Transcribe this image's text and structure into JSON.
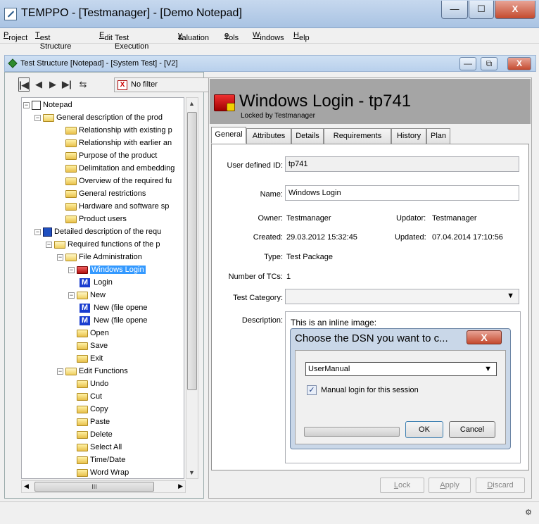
{
  "window": {
    "title": "TEMPPO - [Testmanager] - [Demo Notepad]",
    "minimize": "—",
    "maximize": "☐",
    "close": "X"
  },
  "menu": [
    {
      "pre": "",
      "ul": "P",
      "post": "roject"
    },
    {
      "pre": "",
      "ul": "T",
      "post": "est Structure"
    },
    {
      "pre": "",
      "ul": "E",
      "post": "dit"
    },
    {
      "pre": "Test Execution",
      "ul": "",
      "post": ""
    },
    {
      "pre": "E",
      "ul": "v",
      "post": "aluation"
    },
    {
      "pre": "T",
      "ul": "o",
      "post": "ols"
    },
    {
      "pre": "",
      "ul": "W",
      "post": "indows"
    },
    {
      "pre": "",
      "ul": "H",
      "post": "elp"
    }
  ],
  "inner_window": {
    "title": "Test Structure [Notepad] - [System Test] - [V2]",
    "minimize": "—",
    "restore": "⧉",
    "close": "X"
  },
  "tree_toolbar": {
    "filter_label": "No filter"
  },
  "tree": [
    {
      "label": "Notepad",
      "level": 0,
      "type": "book",
      "exp": "−"
    },
    {
      "label": "General description of the prod",
      "level": 1,
      "type": "open",
      "exp": "−"
    },
    {
      "label": "Relationship with existing p",
      "level": 3,
      "type": "folder"
    },
    {
      "label": "Relationship with earlier an",
      "level": 3,
      "type": "folder"
    },
    {
      "label": "Purpose of the product",
      "level": 3,
      "type": "folder"
    },
    {
      "label": "Delimitation and embedding",
      "level": 3,
      "type": "folder"
    },
    {
      "label": "Overview of the required fu",
      "level": 3,
      "type": "folder"
    },
    {
      "label": "General restrictions",
      "level": 3,
      "type": "folder"
    },
    {
      "label": "Hardware and software sp",
      "level": 3,
      "type": "folder"
    },
    {
      "label": "Product users",
      "level": 3,
      "type": "folder"
    },
    {
      "label": "Detailed description of the requ",
      "level": 1,
      "type": "book2",
      "exp": "−"
    },
    {
      "label": "Required functions of the p",
      "level": 2,
      "type": "open",
      "exp": "−"
    },
    {
      "label": "File Administration",
      "level": 3,
      "type": "open",
      "exp": "−"
    },
    {
      "label": "Windows Login",
      "level": 4,
      "type": "red",
      "exp": "−",
      "selected": true
    },
    {
      "label": "Login",
      "level": 5,
      "type": "m"
    },
    {
      "label": "New",
      "level": 4,
      "type": "open",
      "exp": "−"
    },
    {
      "label": "New (file opene",
      "level": 5,
      "type": "m"
    },
    {
      "label": "New (file opene",
      "level": 5,
      "type": "m"
    },
    {
      "label": "Open",
      "level": 4,
      "type": "folder"
    },
    {
      "label": "Save",
      "level": 4,
      "type": "folder"
    },
    {
      "label": "Exit",
      "level": 4,
      "type": "folder"
    },
    {
      "label": "Edit Functions",
      "level": 3,
      "type": "open",
      "exp": "−"
    },
    {
      "label": "Undo",
      "level": 4,
      "type": "folder"
    },
    {
      "label": "Cut",
      "level": 4,
      "type": "folder"
    },
    {
      "label": "Copy",
      "level": 4,
      "type": "folder"
    },
    {
      "label": "Paste",
      "level": 4,
      "type": "folder"
    },
    {
      "label": "Delete",
      "level": 4,
      "type": "folder"
    },
    {
      "label": "Select All",
      "level": 4,
      "type": "folder"
    },
    {
      "label": "Time/Date",
      "level": 4,
      "type": "folder"
    },
    {
      "label": "Word Wrap",
      "level": 4,
      "type": "folder"
    }
  ],
  "scroll": {
    "h_thumb": "III"
  },
  "detail": {
    "title": "Windows Login - tp741",
    "locked_by": "Locked by Testmanager",
    "tabs": [
      "General",
      "Attributes",
      "Details",
      "Requirements",
      "History",
      "Plan"
    ],
    "active_tab": "General",
    "fields": {
      "user_defined_id_label": "User defined ID:",
      "user_defined_id": "tp741",
      "name_label": "Name:",
      "name": "Windows Login",
      "owner_label": "Owner:",
      "owner": "Testmanager",
      "updator_label": "Updator:",
      "updator": "Testmanager",
      "created_label": "Created:",
      "created": "29.03.2012 15:32:45",
      "updated_label": "Updated:",
      "updated": "07.04.2014 17:10:56",
      "type_label": "Type:",
      "type": "Test Package",
      "num_tcs_label": "Number of TCs:",
      "num_tcs": "1",
      "test_category_label": "Test Category:",
      "test_category": "",
      "description_label": "Description:",
      "description_text": "This is an inline image:"
    },
    "inline_dialog": {
      "title": "Choose the DSN you want to c...",
      "close": "X",
      "dsn_value": "UserManual",
      "checkbox_label": "Manual login for this session",
      "checkbox_checked": true,
      "ok": "OK",
      "cancel": "Cancel"
    },
    "buttons": {
      "lock": {
        "ul": "L",
        "post": "ock"
      },
      "apply": {
        "ul": "A",
        "post": "pply"
      },
      "discard": {
        "ul": "D",
        "post": "iscard"
      }
    }
  },
  "statusbar": {
    "icon": "network-icon"
  }
}
